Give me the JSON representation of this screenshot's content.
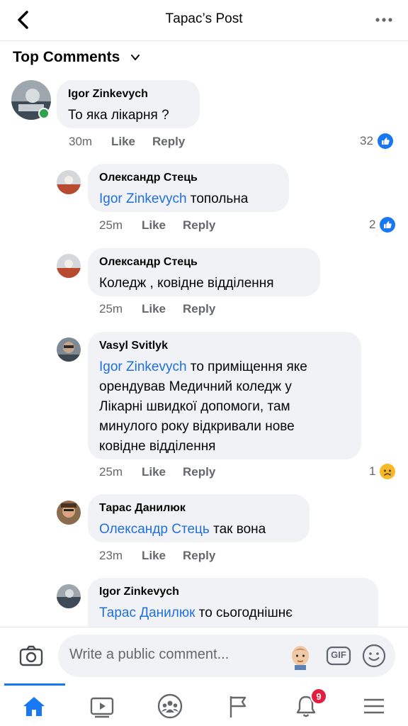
{
  "header": {
    "title": "Тарас’s Post"
  },
  "sort": {
    "label": "Top Comments"
  },
  "comments": [
    {
      "author": "Igor Zinkevych",
      "text": "То яка лікарня ?",
      "time": "30m",
      "like": "Like",
      "reply": "Reply",
      "reaction_count": "32",
      "reaction": "like-icon"
    },
    {
      "author": "Олександр Стець",
      "mention": "Igor Zinkevych",
      "text": " топольна",
      "time": "25m",
      "like": "Like",
      "reply": "Reply",
      "reaction_count": "2",
      "reaction": "like-icon"
    },
    {
      "author": "Олександр Стець",
      "text": "Коледж , ковідне відділення",
      "time": "25m",
      "like": "Like",
      "reply": "Reply"
    },
    {
      "author": "Vasyl Svitlyk",
      "mention": "Igor Zinkevych",
      "text_line1": " то приміщення яке",
      "text_line2": "орендував Медичний коледж  у",
      "text_line3": "Лікарні швидкої допомоги, там",
      "text_line4": "минулого року відкривали нове",
      "text_line5": "ковідне відділення",
      "time": "25m",
      "like": "Like",
      "reply": "Reply",
      "reaction_count": "1",
      "reaction": "sad-icon"
    },
    {
      "author": "Тарас Данилюк",
      "mention": "Олександр Стець",
      "text": " так вона",
      "time": "23m",
      "like": "Like",
      "reply": "Reply"
    },
    {
      "author": "Igor Zinkevych",
      "mention": "Тарас Данилюк",
      "text": " то сьогоднішнє"
    }
  ],
  "composer": {
    "placeholder": "Write a public comment...",
    "gif": "GIF"
  },
  "tabbar": {
    "notifications_badge": "9"
  },
  "colors": {
    "accent": "#1877f2",
    "mention": "#216fdb",
    "bubble": "#f0f2f5",
    "online": "#31a24c",
    "badge": "#e41e3f"
  }
}
